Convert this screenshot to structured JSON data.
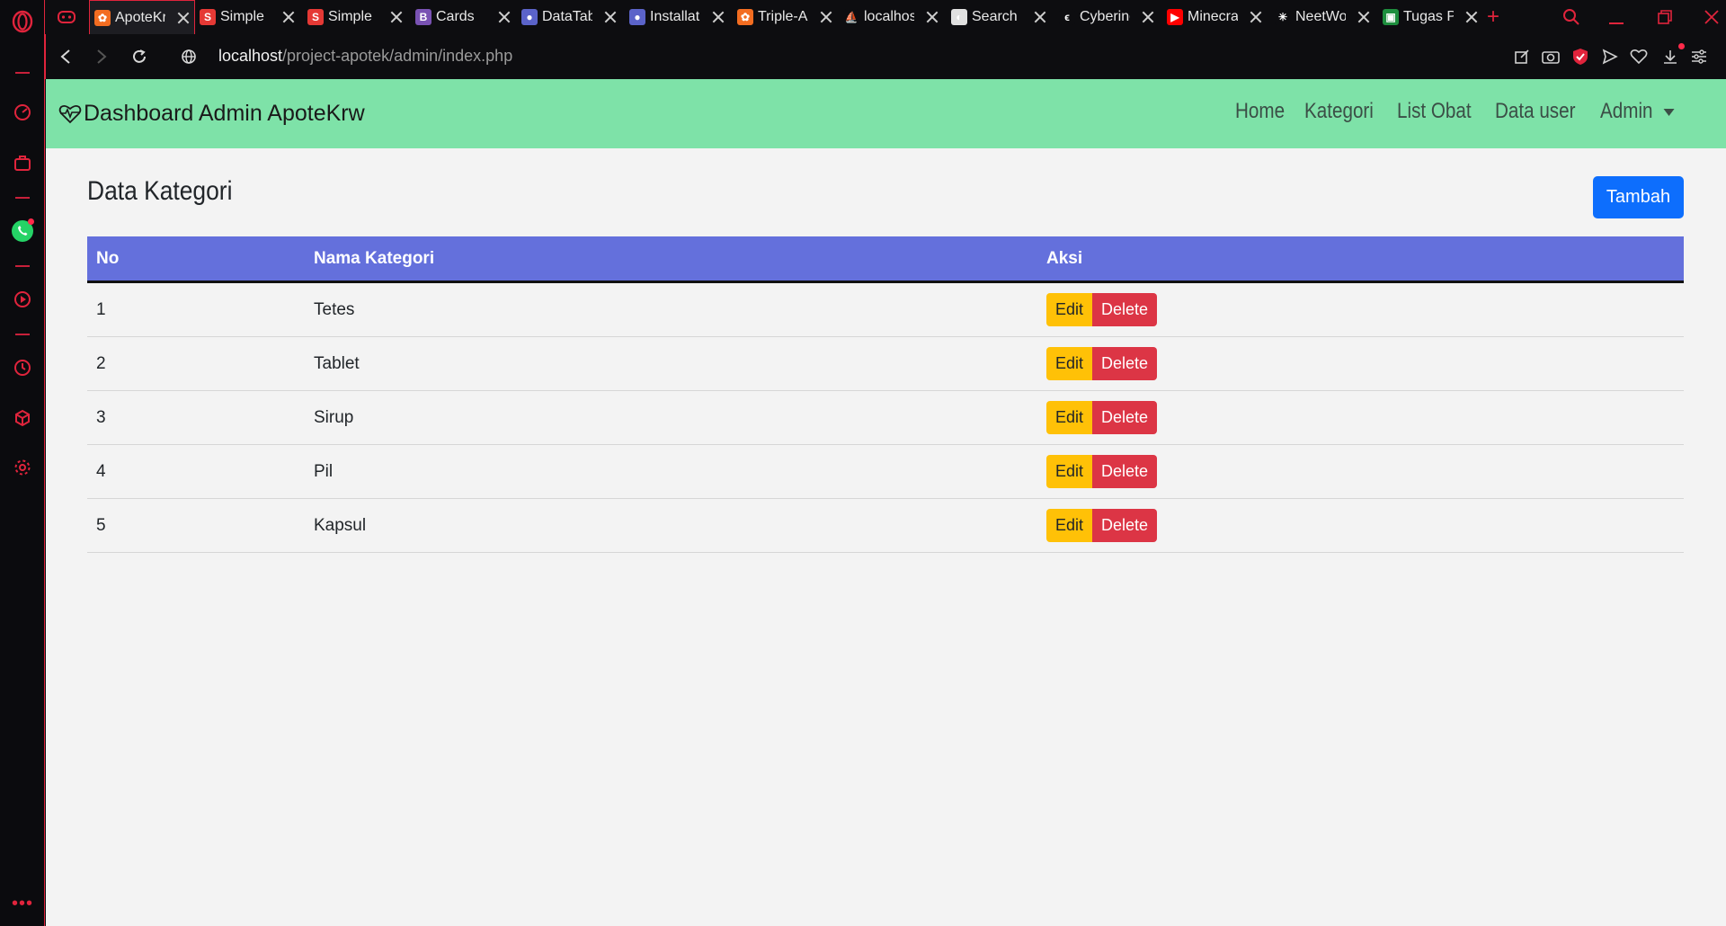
{
  "browser": {
    "tabs": [
      {
        "title": "ApoteKrw",
        "favicon": "xampp-icon",
        "color": "#f36d21",
        "glyph": "✿"
      },
      {
        "title": "Simple",
        "favicon": "s-icon",
        "color": "#e53935",
        "glyph": "S"
      },
      {
        "title": "Simple",
        "favicon": "s-icon",
        "color": "#e53935",
        "glyph": "S"
      },
      {
        "title": "Cards",
        "favicon": "bootstrap-icon",
        "color": "#7952b3",
        "glyph": "B"
      },
      {
        "title": "DataTables",
        "favicon": "datatables-icon",
        "color": "#5b63c9",
        "glyph": "●"
      },
      {
        "title": "Installation",
        "favicon": "datatables-icon",
        "color": "#5b63c9",
        "glyph": "●"
      },
      {
        "title": "Triple-A",
        "favicon": "xampp-icon",
        "color": "#f36d21",
        "glyph": "✿"
      },
      {
        "title": "localhost",
        "favicon": "phpmyadmin-icon",
        "color": "#0d0d10",
        "glyph": "⛵"
      },
      {
        "title": "Search",
        "favicon": "globe-icon",
        "color": "#e0e0e0",
        "glyph": "◐"
      },
      {
        "title": "Cybering",
        "favicon": "cyber-icon",
        "color": "#0d0d10",
        "glyph": "ϵ"
      },
      {
        "title": "Minecraft",
        "favicon": "youtube-icon",
        "color": "#ff0000",
        "glyph": "▶"
      },
      {
        "title": "NeetWork",
        "favicon": "react-icon",
        "color": "#0d0d10",
        "glyph": "✳"
      },
      {
        "title": "Tugas P",
        "favicon": "classroom-icon",
        "color": "#1e8e3e",
        "glyph": "▣"
      }
    ],
    "url_host": "localhost",
    "url_path": "/project-apotek/admin/index.php"
  },
  "navbar": {
    "brand": "Dashboard Admin ApoteKrw",
    "links": [
      "Home",
      "Kategori",
      "List Obat",
      "Data user",
      "Admin"
    ]
  },
  "main": {
    "title": "Data Kategori",
    "add_label": "Tambah",
    "table": {
      "headers": [
        "No",
        "Nama Kategori",
        "Aksi"
      ],
      "rows": [
        {
          "no": "1",
          "name": "Tetes"
        },
        {
          "no": "2",
          "name": "Tablet"
        },
        {
          "no": "3",
          "name": "Sirup"
        },
        {
          "no": "4",
          "name": "Pil"
        },
        {
          "no": "5",
          "name": "Kapsul"
        }
      ],
      "edit_label": "Edit",
      "delete_label": "Delete"
    }
  },
  "colors": {
    "navbar": "#7ee2a8",
    "table_header": "#6470dc",
    "primary": "#0d6efd",
    "warning": "#ffc107",
    "danger": "#dc3545",
    "opera_red": "#e0243c"
  }
}
